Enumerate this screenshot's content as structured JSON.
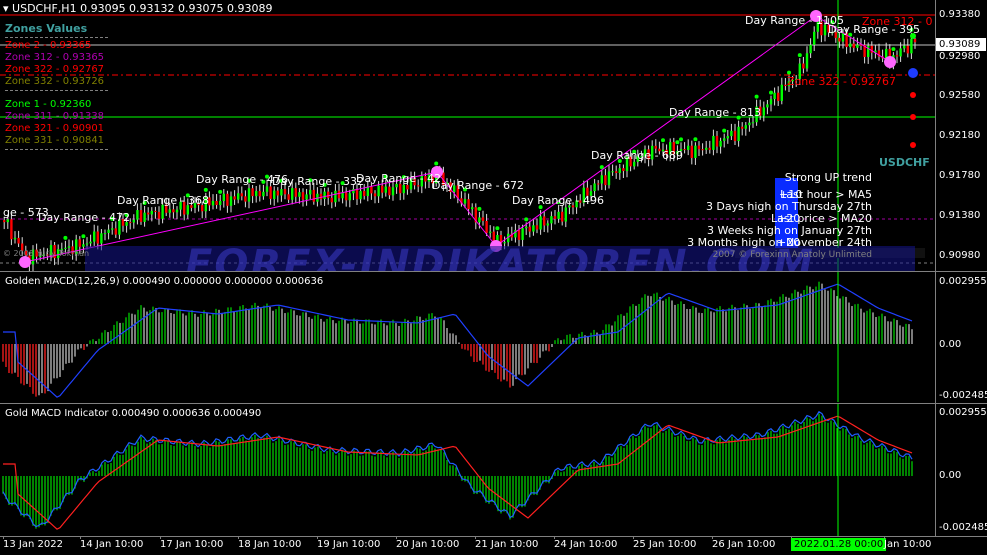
{
  "chart": {
    "symbol_header": "USDCHF,H1  0.93095 0.93132 0.93075 0.93089",
    "current_price": "0.93089",
    "colors": {
      "bg": "#000000",
      "bull": "#00ff00",
      "bear": "#ff0000",
      "zone_line_red": "#ff0000",
      "zone_line_green": "#00ff00",
      "range_line": "#ff00ff",
      "info_blue": "#0000ff",
      "watermark": "#1e1e9a"
    },
    "price_ticks": [
      "0.93380",
      "0.92980",
      "0.92580",
      "0.92180",
      "0.91780",
      "0.91380",
      "0.90980"
    ],
    "zones_title": "Zones Values",
    "zones": [
      {
        "label": "Zone 2      - 0.93365",
        "color": "#ff0000"
      },
      {
        "label": "Zone 312 - 0.93365",
        "color": "#b000b0"
      },
      {
        "label": "Zone 322 - 0.92767",
        "color": "#ff0000"
      },
      {
        "label": "Zone 332 - 0.93726",
        "color": "#808000"
      },
      {
        "label": "Zone 1      - 0.92360",
        "color": "#00ff00"
      },
      {
        "label": "Zone 311 - 0.91338",
        "color": "#b000b0"
      },
      {
        "label": "Zone 321 - 0.90901",
        "color": "#ff0000"
      },
      {
        "label": "Zone 331 - 0.90841",
        "color": "#808000"
      }
    ],
    "day_ranges": [
      "ge - 573",
      "Day Range - 472",
      "Day Range - 368",
      "Day Range - 476",
      "Day Range - 332",
      "Day Range - 42",
      "Day Range - 672",
      "Day Range - 496",
      "Day Range - 689",
      "Day Range - 813",
      "Day Range - 1105",
      "Day Range - 395"
    ],
    "zone_overlay_labels": [
      "Zone 322 - 0.92767",
      "Zone 312 - 0"
    ],
    "info_panel": {
      "symbol": "USDCHF",
      "lines": [
        "Strong UP trend",
        "Last hour > MA5",
        "3 Days high on Thursday 27th",
        "Last price > MA20",
        "3 Weeks high on January 27th",
        "3 Months high on November 24th",
        "2007 © Forexinn Anatoly Unlimited"
      ],
      "arrow_labels": [
        "+10",
        "+20",
        "+20"
      ]
    },
    "watermark": "FOREX-INDIKATOREN.COM",
    "copyright_left": "© 2008 Yuriy Tokman"
  },
  "golden_macd": {
    "header": "Golden MACD(12,26,9) 0.000490 0.000000 0.000000 0.000636",
    "ticks": [
      "0.002955",
      "0.00",
      "-0.002485"
    ]
  },
  "gold_macd": {
    "header": "Gold MACD Indicator 0.000490 0.000636 0.000490",
    "ticks": [
      "0.002955",
      "0.00",
      "-0.002485"
    ]
  },
  "time_axis": {
    "labels": [
      "13 Jan 2022",
      "14 Jan 10:00",
      "17 Jan 10:00",
      "18 Jan 10:00",
      "19 Jan 10:00",
      "20 Jan 10:00",
      "21 Jan 10:00",
      "24 Jan 10:00",
      "25 Jan 10:00",
      "26 Jan 10:00",
      "2022.01.28 00:00",
      "Jan 10:00"
    ]
  }
}
